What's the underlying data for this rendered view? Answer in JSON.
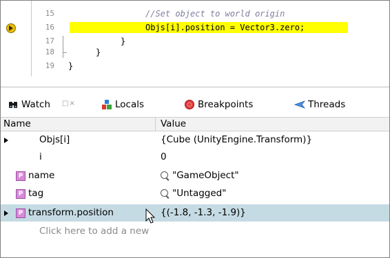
{
  "code": {
    "lines": [
      {
        "num": "15",
        "text": "//Set object to world origin",
        "comment": true
      },
      {
        "num": "16",
        "text": "Objs[i].position = Vector3.zero;",
        "comment": false
      },
      {
        "num": "17",
        "text": "}",
        "comment": false
      },
      {
        "num": "18",
        "text": "}",
        "comment": false
      },
      {
        "num": "19",
        "text": "}",
        "comment": false
      }
    ],
    "highlight_color": "#ffff00"
  },
  "tabs": [
    {
      "label": "Watch",
      "icon": "binoculars-icon",
      "close": "□×"
    },
    {
      "label": "Locals",
      "icon": "locals-blocks-icon"
    },
    {
      "label": "Breakpoints",
      "icon": "breakpoint-icon"
    },
    {
      "label": "Threads",
      "icon": "threads-icon"
    }
  ],
  "table": {
    "columns": [
      "Name",
      "Value"
    ],
    "rows": [
      {
        "name": "Objs[i]",
        "value": "{Cube (UnityEngine.Transform)}",
        "expandable": true,
        "icon": ""
      },
      {
        "name": "i",
        "value": "0",
        "expandable": false,
        "icon": ""
      },
      {
        "name": "name",
        "value": "\"GameObject\"",
        "expandable": false,
        "icon": "property-icon",
        "magnifier": true
      },
      {
        "name": "tag",
        "value": "\"Untagged\"",
        "expandable": false,
        "icon": "property-icon",
        "magnifier": true
      },
      {
        "name": "transform.position",
        "value": "{(-1.8, -1.3, -1.9)}",
        "expandable": true,
        "icon": "property-icon",
        "selected": true
      }
    ],
    "add_placeholder": "Click here to add a new",
    "property_badge": "P",
    "selected_color": "#c5dbe4"
  }
}
